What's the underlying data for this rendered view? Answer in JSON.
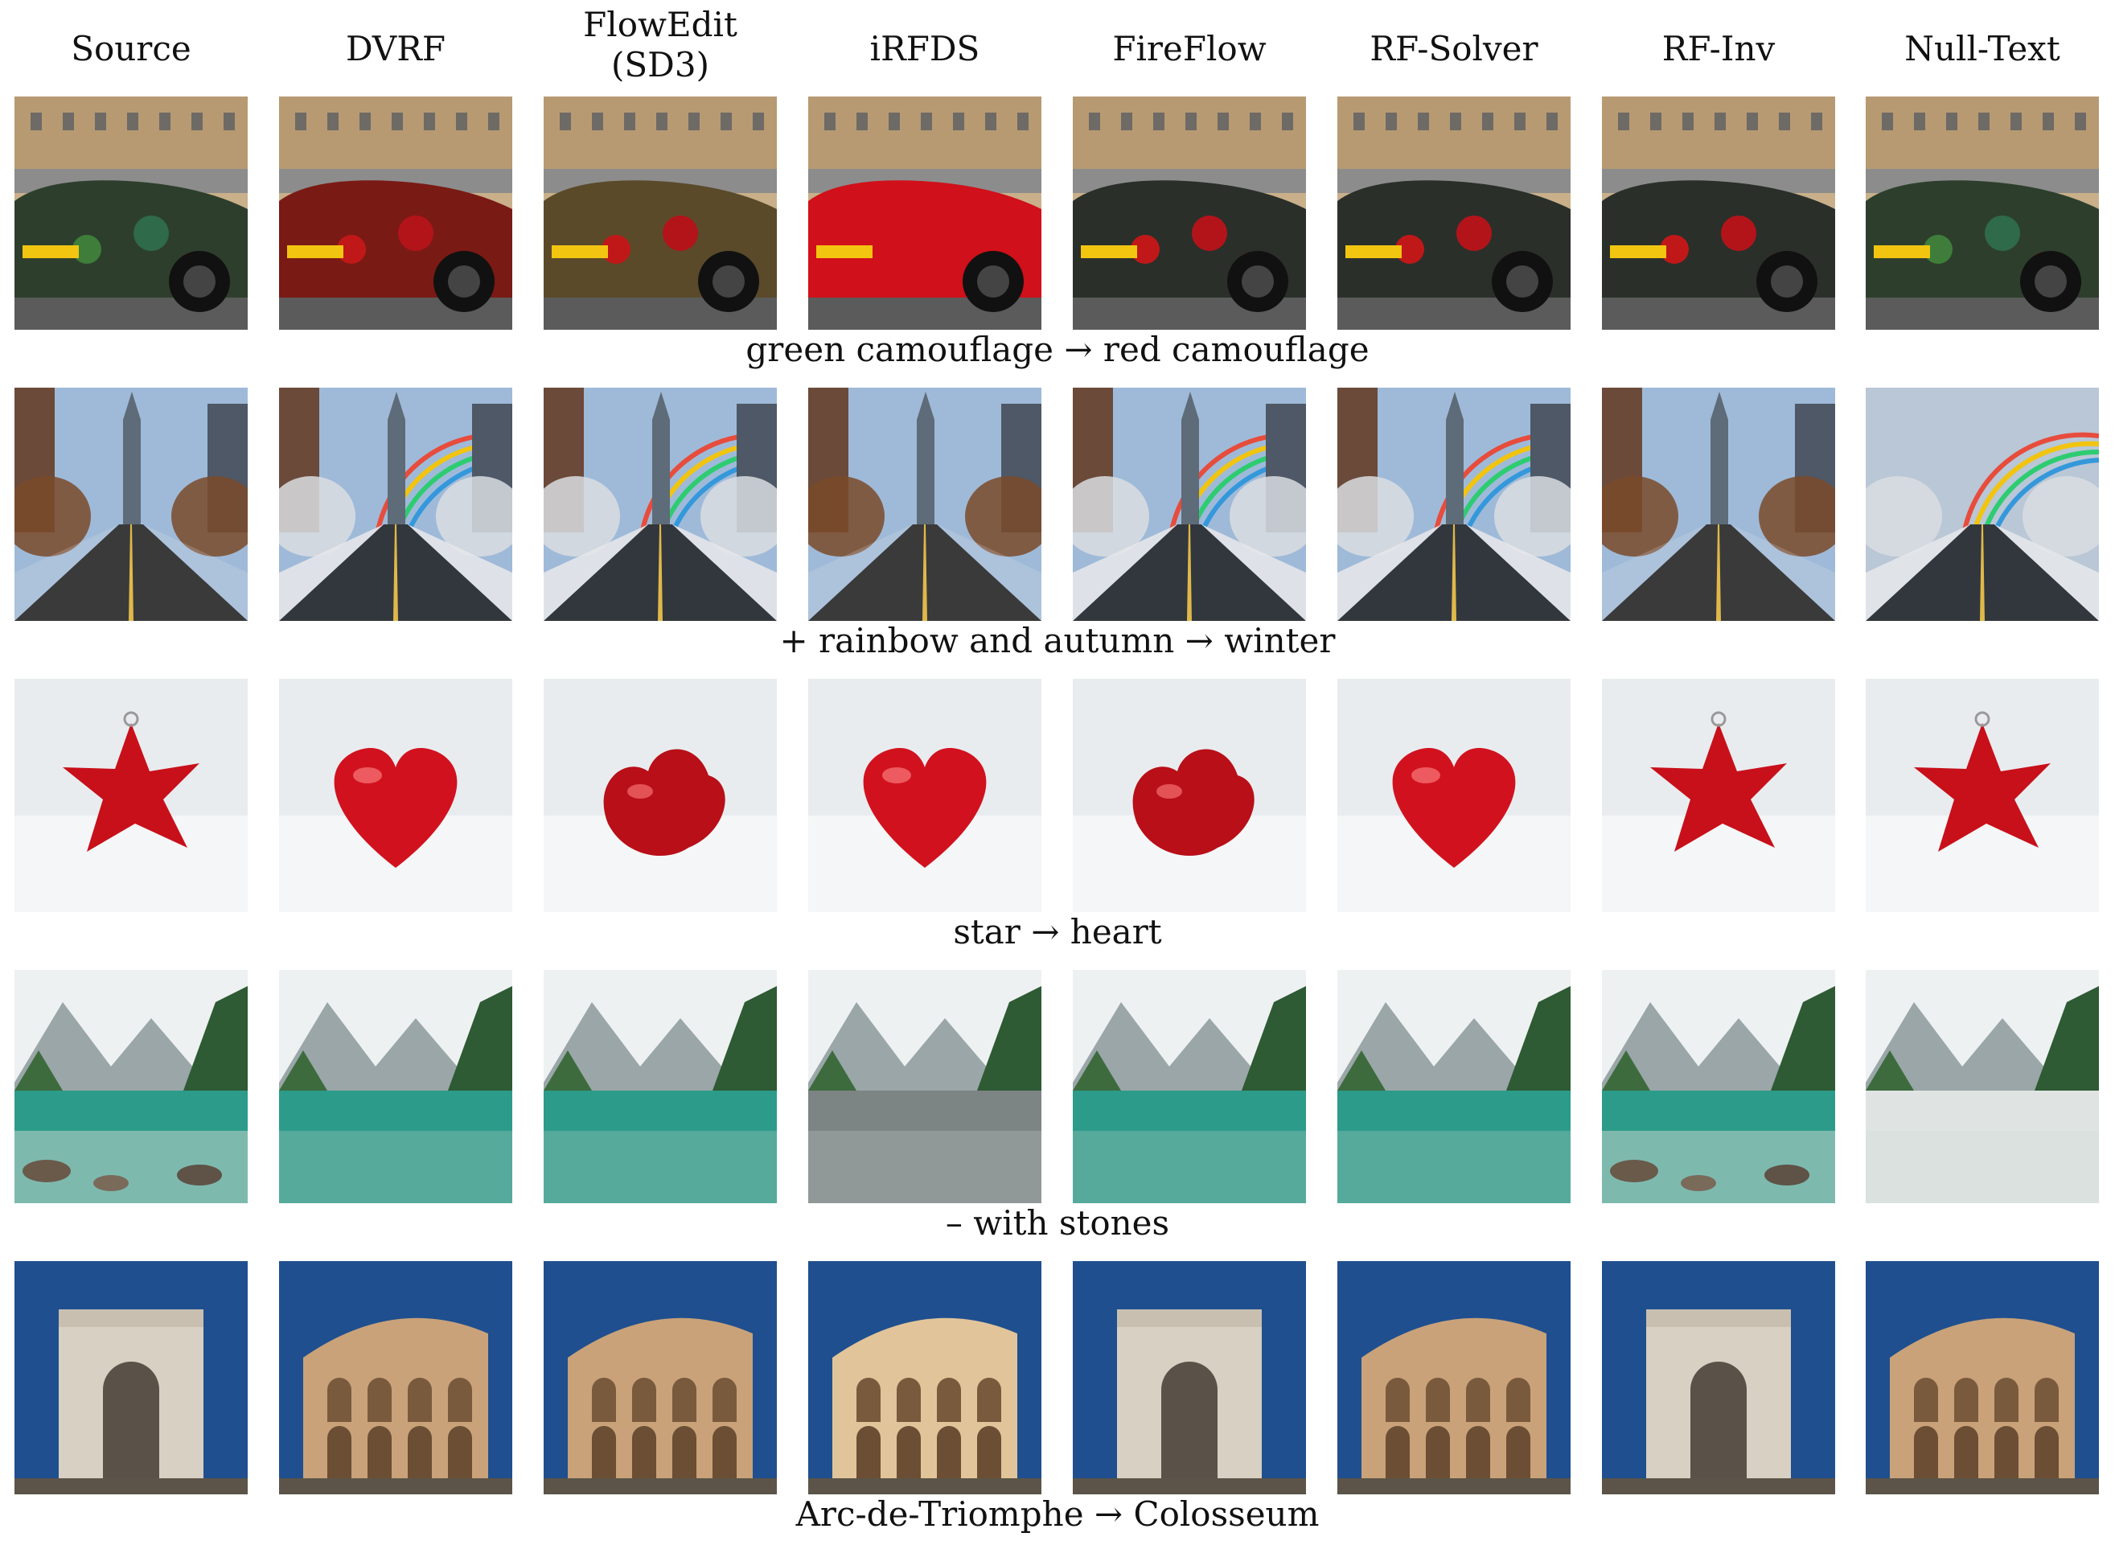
{
  "columns": [
    "Source",
    "DVRF",
    "FlowEdit\n(SD3)",
    "iRFDS",
    "FireFlow",
    "RF-Solver",
    "RF-Inv",
    "Null-Text"
  ],
  "rows": [
    {
      "caption": "green camouflage → red camouflage",
      "scene": "car",
      "variants": [
        "green",
        "red",
        "mixed",
        "solidred",
        "redgreen",
        "redgreen",
        "redgreen",
        "green"
      ]
    },
    {
      "caption": "+ rainbow and autumn → winter",
      "scene": "street",
      "variants": [
        "autumn",
        "winter",
        "winter",
        "autumn",
        "winter",
        "winter",
        "autumn",
        "rainbowfield"
      ]
    },
    {
      "caption": "star → heart",
      "scene": "ornament",
      "variants": [
        "star",
        "heart",
        "blob",
        "heart",
        "blob",
        "heart",
        "star",
        "star"
      ]
    },
    {
      "caption": "– with stones",
      "scene": "lake",
      "variants": [
        "stones",
        "clear",
        "clear",
        "grey",
        "clear",
        "clear",
        "stones",
        "forest"
      ]
    },
    {
      "caption": "Arc-de-Triomphe → Colosseum",
      "scene": "monument",
      "variants": [
        "arc",
        "colosseum",
        "colosseum",
        "arches",
        "arc",
        "colosseum",
        "arc",
        "colosseum"
      ]
    }
  ],
  "colors": {
    "sky": "#1f4f8e",
    "snow": "#e9ecef",
    "ornament": "#c8101a",
    "lake": "#2c9b8a"
  }
}
